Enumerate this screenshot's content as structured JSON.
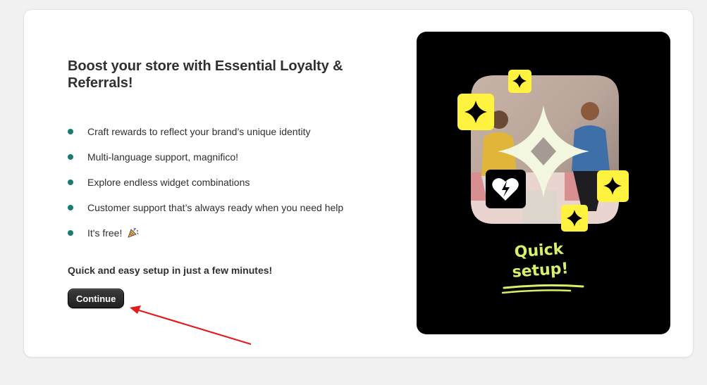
{
  "card": {
    "title": "Boost your store with Essential Loyalty & Referrals!",
    "features": [
      "Craft rewards to reflect your brand’s unique identity",
      "Multi-language support, magnifico!",
      "Explore endless widget combinations",
      "Customer support that’s always ready when you need help",
      "It's free!"
    ],
    "setup_note": "Quick and easy setup in just a few minutes!",
    "continue_label": "Continue"
  },
  "promo": {
    "headline_line1": "Quick",
    "headline_line2": "setup!"
  },
  "colors": {
    "bullet": "#1b7a72",
    "promo_bg": "#000000",
    "accent_yellow": "#fff340",
    "headline_green": "#d7f06c",
    "annotation_arrow": "#e21c1c"
  }
}
